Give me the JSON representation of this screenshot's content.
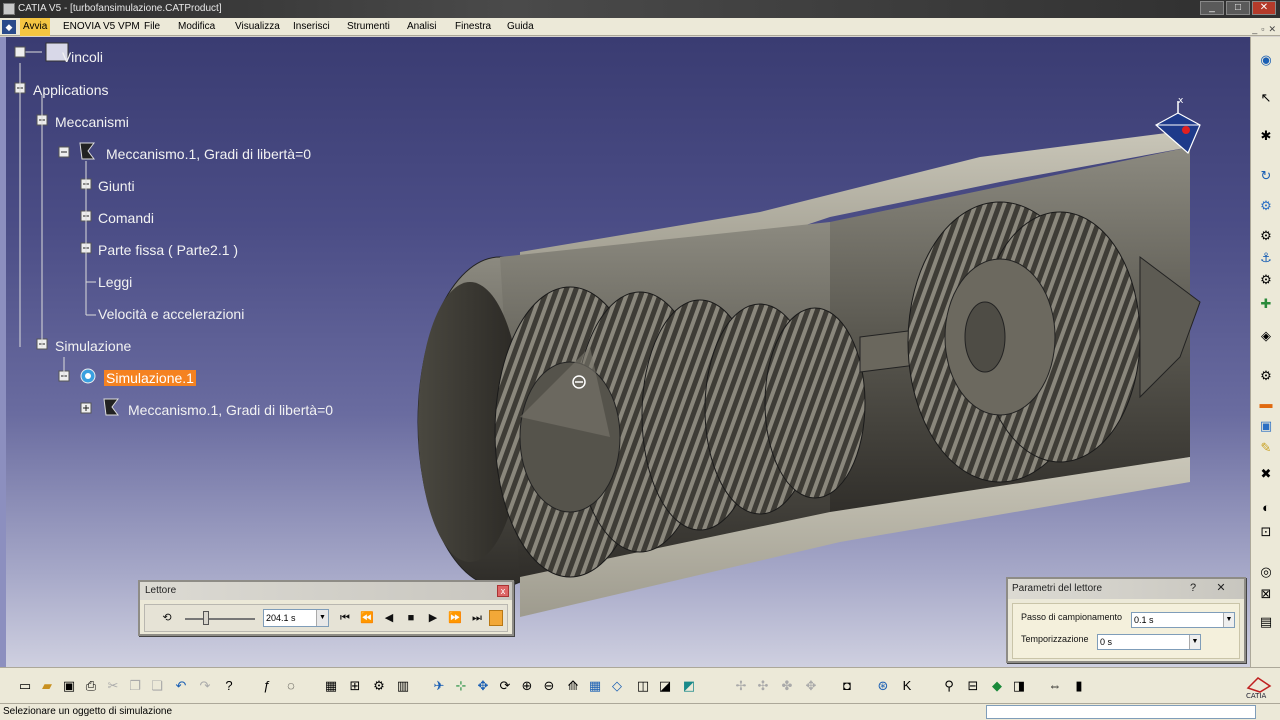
{
  "window": {
    "title": "CATIA V5 - [turbofansimulazione.CATProduct]",
    "buttons": [
      "_",
      "□",
      "✕"
    ]
  },
  "menu": {
    "items": [
      "Avvia",
      "ENOVIA V5 VPM",
      "File",
      "Modifica",
      "Visualizza",
      "Inserisci",
      "Strumenti",
      "Analisi",
      "Finestra",
      "Guida"
    ],
    "active": "Avvia"
  },
  "tree": {
    "vincoli": "Vincoli",
    "applications": "Applications",
    "meccanismi": "Meccanismi",
    "meccanismo": "Meccanismo.1, Gradi di libertà=0",
    "giunti": "Giunti",
    "comandi": "Comandi",
    "parte_fissa": "Parte fissa ( Parte2.1 )",
    "leggi": "Leggi",
    "velocita": "Velocità e accelerazioni",
    "simulazione": "Simulazione",
    "simulazione1": "Simulazione.1",
    "sim_meccanismo": "Meccanismo.1, Gradi di libertà=0"
  },
  "compass": {
    "axis_label": "x"
  },
  "lettore": {
    "title": "Lettore",
    "time_value": "204.1 s",
    "close_glyph": "x",
    "controls": [
      "⏮",
      "⏪",
      "◀",
      "■",
      "▶",
      "⏩",
      "⏭"
    ]
  },
  "parametri": {
    "title": "Parametri del lettore",
    "help_glyph": "?",
    "close_glyph": "✕",
    "passo_label": "Passo di campionamento",
    "passo_value": "0.1 s",
    "temporizzazione_label": "Temporizzazione",
    "temporizzazione_value": "0 s"
  },
  "status": {
    "message": "Selezionare un oggetto di simulazione"
  },
  "brand": {
    "label": "CATIA"
  },
  "colors": {
    "selection": "#f58220",
    "background_top": "#3a3c72",
    "background_bottom": "#cfd0e0"
  }
}
